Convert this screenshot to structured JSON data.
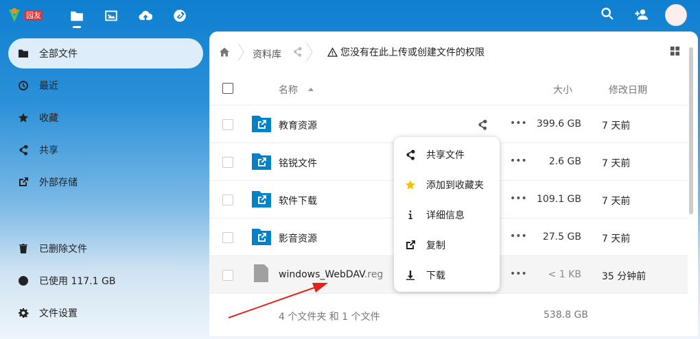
{
  "header": {
    "logo_text": "园友"
  },
  "sidebar": {
    "items": [
      {
        "label": "全部文件",
        "icon": "folder-icon"
      },
      {
        "label": "最近",
        "icon": "clock-icon"
      },
      {
        "label": "收藏",
        "icon": "star-icon"
      },
      {
        "label": "共享",
        "icon": "share-icon"
      },
      {
        "label": "外部存储",
        "icon": "external-link-icon"
      }
    ],
    "deleted": "已删除文件",
    "quota": "已使用 117.1 GB",
    "settings": "文件设置"
  },
  "breadcrumb": {
    "folder": "资料库",
    "warning": "您没有在此上传或创建文件的权限"
  },
  "table": {
    "col_name": "名称",
    "col_size": "大小",
    "col_modified": "修改日期",
    "rows": [
      {
        "name": "教育资源",
        "ext": "",
        "size": "399.6 GB",
        "modified": "7 天前",
        "type": "external-folder"
      },
      {
        "name": "铭锐文件",
        "ext": "",
        "size": "2.6 GB",
        "modified": "7 天前",
        "type": "external-folder"
      },
      {
        "name": "软件下载",
        "ext": "",
        "size": "109.1 GB",
        "modified": "7 天前",
        "type": "external-folder"
      },
      {
        "name": "影音资源",
        "ext": "",
        "size": "27.5 GB",
        "modified": "7 天前",
        "type": "external-folder"
      },
      {
        "name": "windows_WebDAV",
        "ext": ".reg",
        "size": "< 1 KB",
        "modified": "35 分钟前",
        "type": "file"
      }
    ],
    "summary_text": "4 个文件夹 和 1 个文件",
    "summary_size": "538.8 GB"
  },
  "context_menu": {
    "items": [
      {
        "label": "共享文件",
        "icon": "share-icon"
      },
      {
        "label": "添加到收藏夹",
        "icon": "star-icon"
      },
      {
        "label": "详细信息",
        "icon": "info-icon"
      },
      {
        "label": "复制",
        "icon": "external-link-icon"
      },
      {
        "label": "下载",
        "icon": "download-icon"
      }
    ]
  },
  "colors": {
    "primary": "#0082c9",
    "folder": "#0082c9",
    "star": "#f5c000",
    "arrow": "#e5231b"
  }
}
